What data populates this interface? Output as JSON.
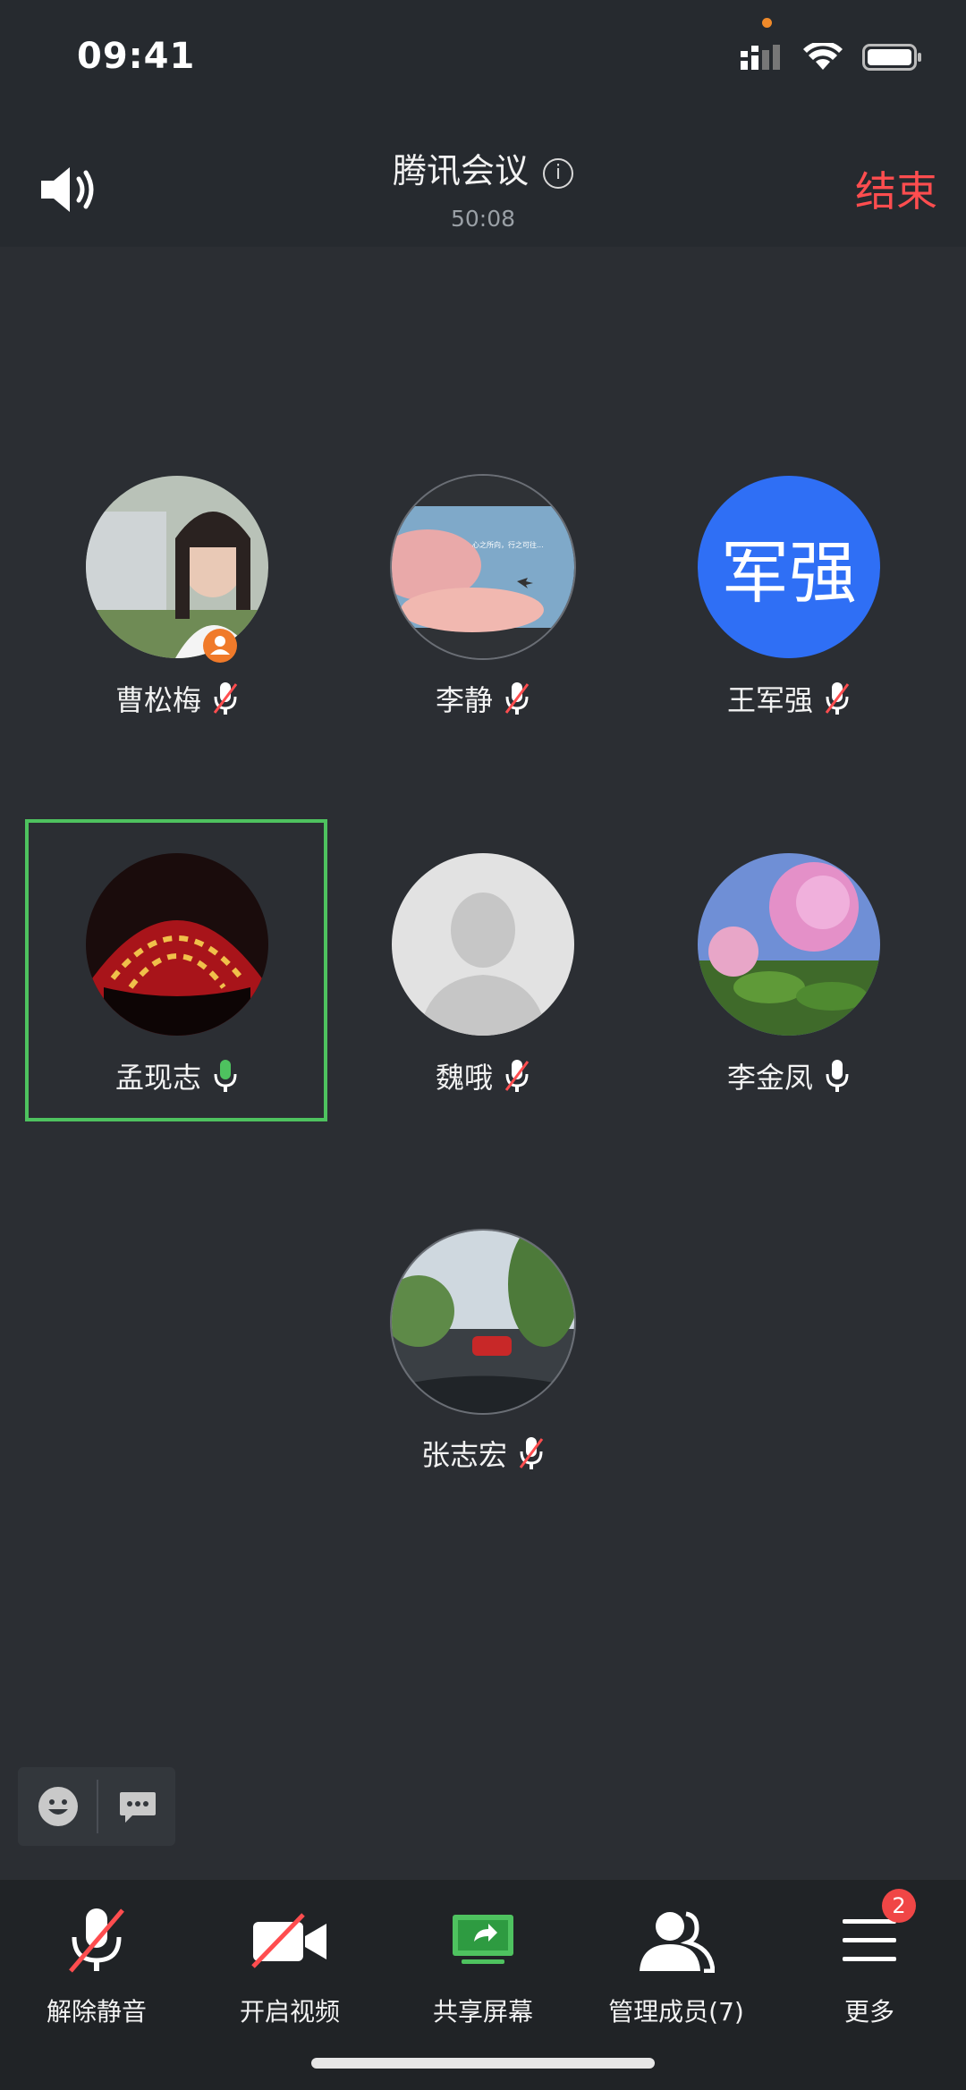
{
  "status_bar": {
    "time": "09:41"
  },
  "header": {
    "title": "腾讯会议",
    "duration": "50:08",
    "end_label": "结束"
  },
  "participants": [
    {
      "name": "曹松梅",
      "mic": "muted",
      "avatar": "photo",
      "host": true
    },
    {
      "name": "李静",
      "mic": "muted",
      "avatar": "photo"
    },
    {
      "name": "王军强",
      "mic": "muted",
      "avatar": "text",
      "avatar_text": "军强",
      "avatar_color": "#2f6ff5"
    },
    {
      "name": "孟现志",
      "mic": "speaking",
      "avatar": "photo",
      "active": true
    },
    {
      "name": "魏哦",
      "mic": "muted",
      "avatar": "placeholder"
    },
    {
      "name": "李金凤",
      "mic": "on",
      "avatar": "photo"
    },
    {
      "name": "张志宏",
      "mic": "muted",
      "avatar": "photo"
    }
  ],
  "toolbar": {
    "unmute_label": "解除静音",
    "video_label": "开启视频",
    "share_label": "共享屏幕",
    "members_label": "管理成员(7)",
    "more_label": "更多",
    "more_badge": "2"
  },
  "colors": {
    "accent_green": "#4ec25f",
    "danger": "#ff4d4f",
    "avatar_blue": "#2f6ff5"
  }
}
